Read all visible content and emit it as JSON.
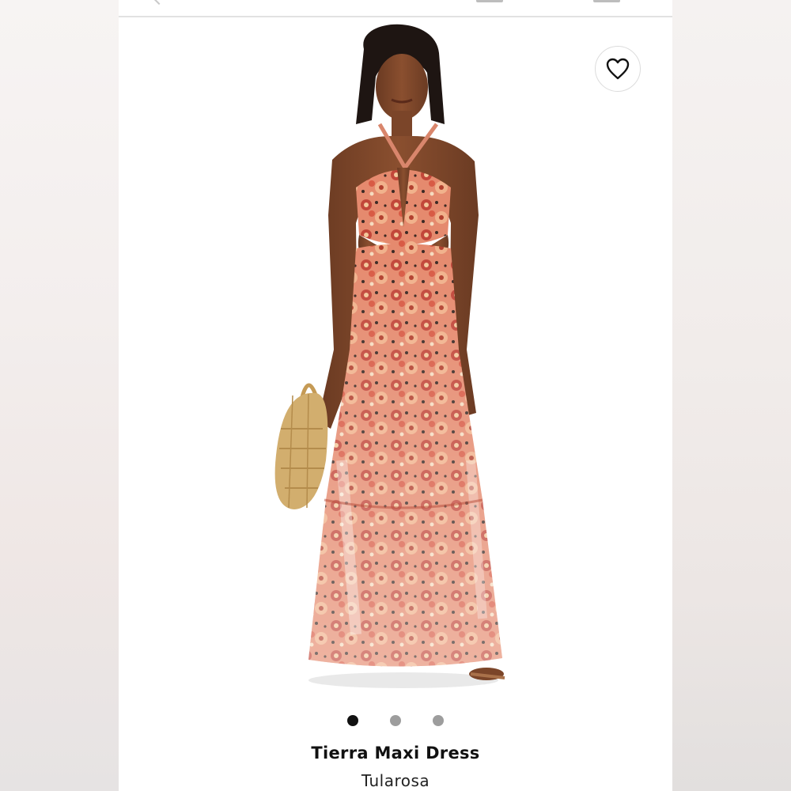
{
  "product": {
    "name": "Tierra Maxi Dress",
    "brand": "Tularosa"
  },
  "gallery": {
    "image_alt": "Model wearing floral print halter maxi dress holding a woven straw bag",
    "image_count": 3,
    "active_index": 0
  },
  "icons": {
    "favorite": "heart-outline-icon",
    "back": "chevron-left-icon"
  },
  "colors": {
    "accent": "#111111",
    "dot_inactive": "#9d9d9d",
    "dress_primary": "#d36a52",
    "dress_secondary": "#f0c9a8",
    "bag": "#d2ae6e"
  }
}
